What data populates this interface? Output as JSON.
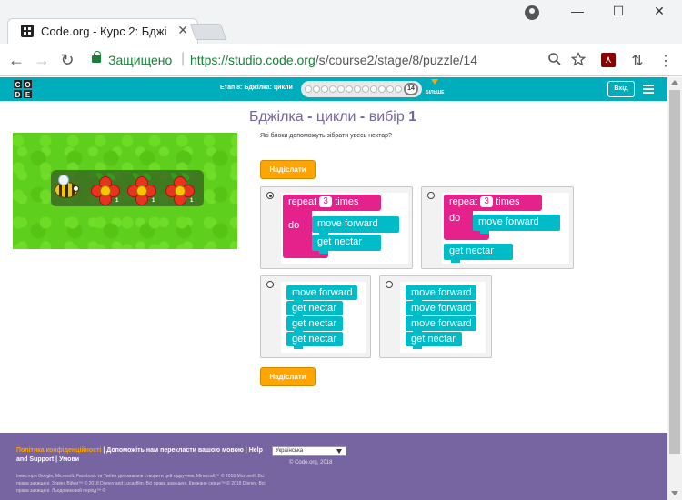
{
  "browser": {
    "tab_title": "Code.org - Курс 2: Бджі",
    "tab_close": "✕",
    "secure_label": "Защищено",
    "url_host": "https://studio.code.org",
    "url_path": "/s/course2/stage/8/puzzle/14",
    "nav": {
      "back": "←",
      "forward": "→",
      "reload": "↻"
    },
    "window": {
      "minimize": "—",
      "maximize": "☐",
      "close": "✕"
    },
    "icons": [
      "search-icon",
      "star-icon",
      "pdf-icon",
      "sync-icon",
      "menu-icon"
    ]
  },
  "header": {
    "logo_letters": [
      "C",
      "O",
      "D",
      "E"
    ],
    "stage_label": "Етап 8: Бджілка: цикли",
    "current_puzzle": "14",
    "more_label": "БІЛЬШЕ",
    "signin_label": "Вхід"
  },
  "puzzle": {
    "title_main": "Бджілка",
    "title_sep1": " - ",
    "title_part2": "цикли",
    "title_sep2": " - ",
    "title_part3": "вибір ",
    "title_num": "1",
    "question": "Які блоки допоможуть зібрати увесь нектар?",
    "submit_label": "Надіслати",
    "flower_counts": [
      "1",
      "1",
      "1"
    ]
  },
  "blocks": {
    "repeat": "repeat",
    "times": "times",
    "do": "do",
    "repeat_count": "3",
    "move_forward": "move forward",
    "get_nectar": "get nectar"
  },
  "footer": {
    "privacy": "Політика конфіденційності",
    "sep1": " | ",
    "translate": "Допоможіть нам перекласти вашою мовою",
    "sep2": " | ",
    "help": "Help and Support",
    "sep3": " | ",
    "terms": "Умови",
    "language": "Українська",
    "copyright": "© Code.org, 2018",
    "legal": "Інвестори Google, Microsoft, Facebook та Twitter допомагали створити цей підручник. Minecraft™ © 2018 Microsoft. Всі права захищені. Зоряні Війни™ © 2018 Disney and Lucasfilm. Всі права захищені. Крижане серце™ © 2018 Disney. Всі права захищені. Льодовиковий період™ ©"
  },
  "colors": {
    "header_bg": "#00adbc",
    "title": "#7665a0",
    "submit": "#ffa400",
    "loop_block": "#e5218c",
    "cmd_block": "#00bcc8",
    "footer_bg": "#7665a0",
    "grass": "#5fcf1e"
  }
}
